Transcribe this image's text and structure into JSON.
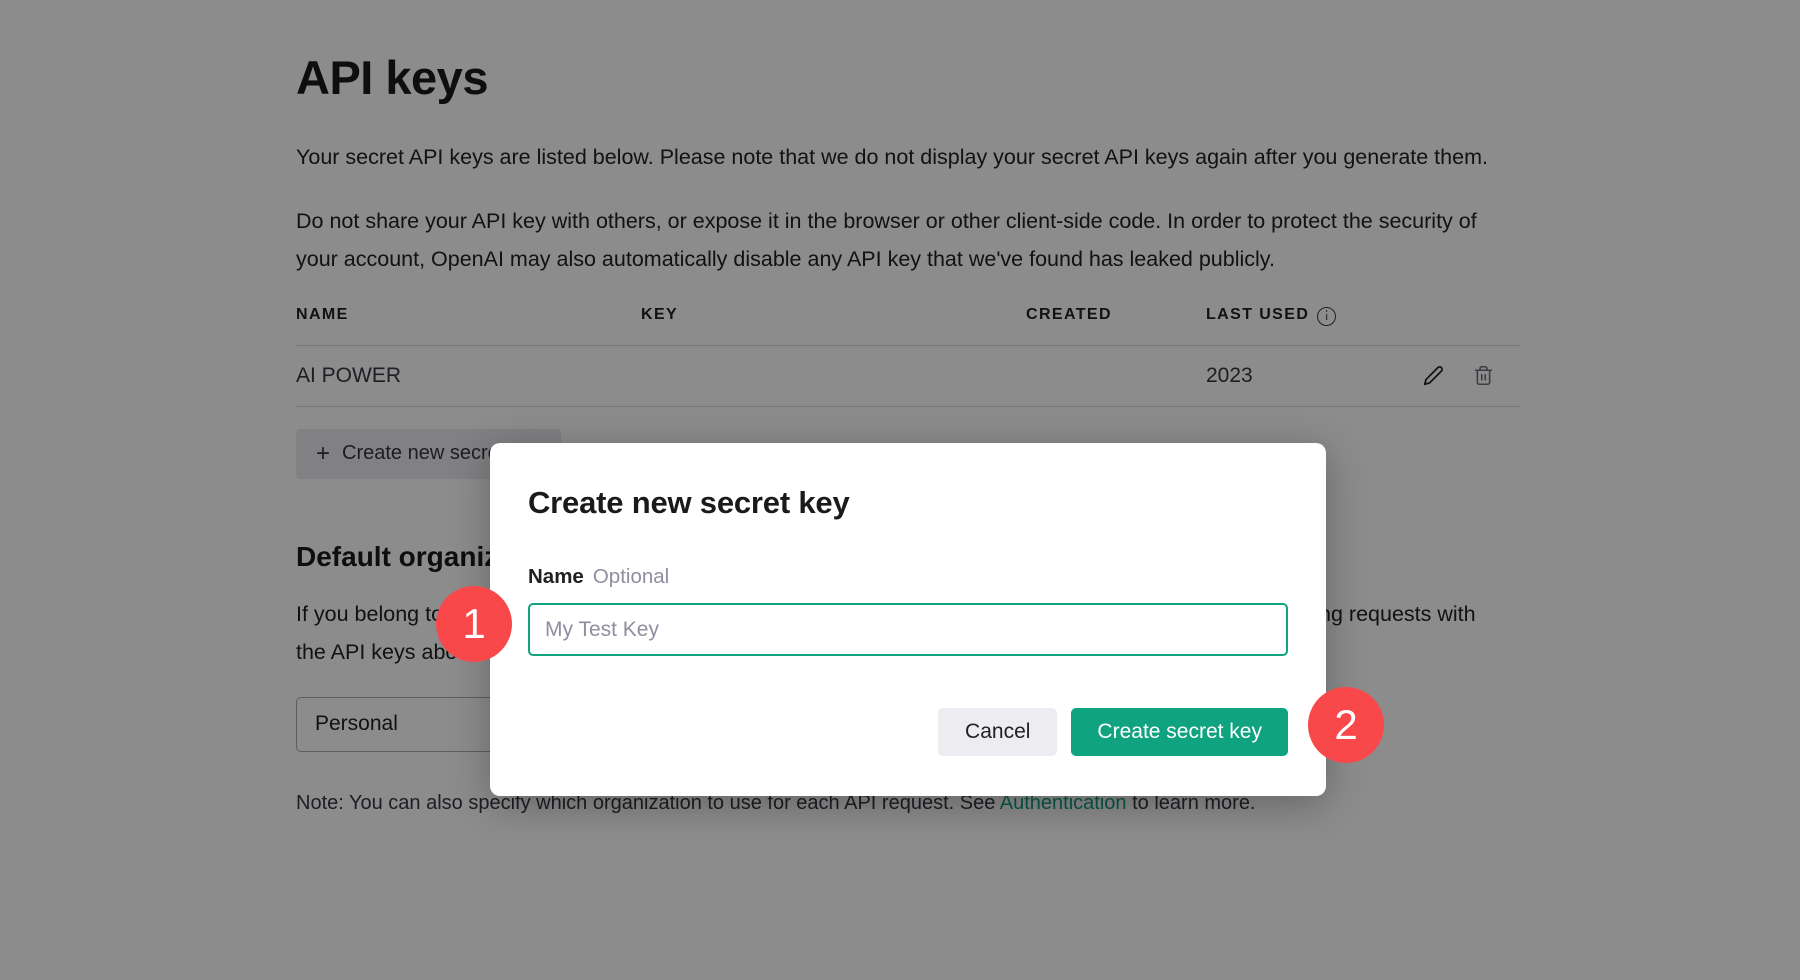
{
  "page": {
    "title": "API keys",
    "paragraphs": [
      "Your secret API keys are listed below. Please note that we do not display your secret API keys again after you generate them.",
      "Do not share your API key with others, or expose it in the browser or other client-side code. In order to protect the security of your account, OpenAI may also automatically disable any API key that we've found has leaked publicly."
    ]
  },
  "keys_table": {
    "columns": [
      {
        "label": "NAME",
        "icon": null
      },
      {
        "label": "KEY",
        "icon": null
      },
      {
        "label": "CREATED",
        "icon": null
      },
      {
        "label": "LAST USED",
        "icon": "info-icon"
      }
    ],
    "rows": [
      {
        "name": "AI POWER",
        "key": "",
        "created": "",
        "last_used": "2023",
        "edit_icon": "pencil-icon",
        "delete_icon": "trash-icon"
      }
    ]
  },
  "create_key_button": {
    "plus": "+",
    "label": "Create new secret key"
  },
  "default_org": {
    "title": "Default organization",
    "description_line1": "If you belong to multiple organizations, this setting controls which organization is used by default",
    "description_line2": "when making requests with the API keys above.",
    "select_value": "Personal",
    "select_chevron": "chevron-down-icon",
    "note_prefix": "Note: You can also specify which organization to use for each API request. See ",
    "note_link": "Authentication",
    "note_suffix": " to learn more."
  },
  "modal": {
    "title": "Create new secret key",
    "field_label": "Name",
    "field_optional": "Optional",
    "input_value": "",
    "input_placeholder": "My Test Key",
    "cancel_label": "Cancel",
    "submit_label": "Create secret key"
  },
  "step_badges": [
    {
      "number": "1"
    },
    {
      "number": "2"
    }
  ],
  "colors": {
    "accent_green": "#10a37f",
    "badge_red": "#f9484a",
    "muted_gray": "#8e8ea0"
  }
}
